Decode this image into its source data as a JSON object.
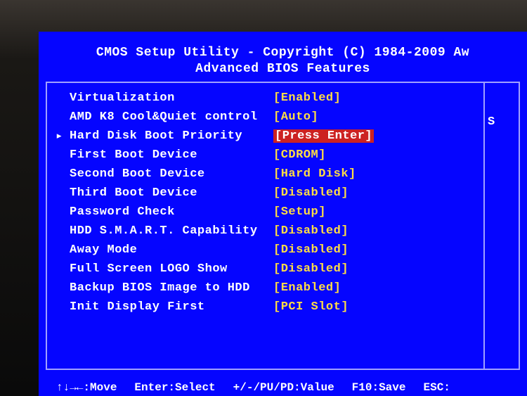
{
  "header": {
    "title": "CMOS Setup Utility - Copyright (C) 1984-2009 Aw",
    "subtitle": "Advanced BIOS Features"
  },
  "settings": [
    {
      "label": "Virtualization",
      "value": "[Enabled]",
      "selected": false,
      "highlight": false
    },
    {
      "label": "AMD K8 Cool&Quiet control",
      "value": "[Auto]",
      "selected": false,
      "highlight": false
    },
    {
      "label": "Hard Disk Boot Priority",
      "value": "[Press Enter]",
      "selected": true,
      "highlight": true
    },
    {
      "label": "First Boot Device",
      "value": "[CDROM]",
      "selected": false,
      "highlight": false
    },
    {
      "label": "Second Boot Device",
      "value": "[Hard Disk]",
      "selected": false,
      "highlight": false
    },
    {
      "label": "Third Boot Device",
      "value": "[Disabled]",
      "selected": false,
      "highlight": false
    },
    {
      "label": "Password Check",
      "value": "[Setup]",
      "selected": false,
      "highlight": false
    },
    {
      "label": "HDD S.M.A.R.T. Capability",
      "value": "[Disabled]",
      "selected": false,
      "highlight": false
    },
    {
      "label": "Away Mode",
      "value": "[Disabled]",
      "selected": false,
      "highlight": false
    },
    {
      "label": "Full Screen LOGO Show",
      "value": "[Disabled]",
      "selected": false,
      "highlight": false
    },
    {
      "label": "Backup BIOS Image to HDD",
      "value": "[Enabled]",
      "selected": false,
      "highlight": false
    },
    {
      "label": "Init Display First",
      "value": "[PCI Slot]",
      "selected": false,
      "highlight": false
    }
  ],
  "right_hint": "S",
  "footer": {
    "move": "↑↓→←:Move",
    "select": "Enter:Select",
    "value": "+/-/PU/PD:Value",
    "save": "F10:Save",
    "exit": "ESC:"
  },
  "indicator_symbol": "▸"
}
